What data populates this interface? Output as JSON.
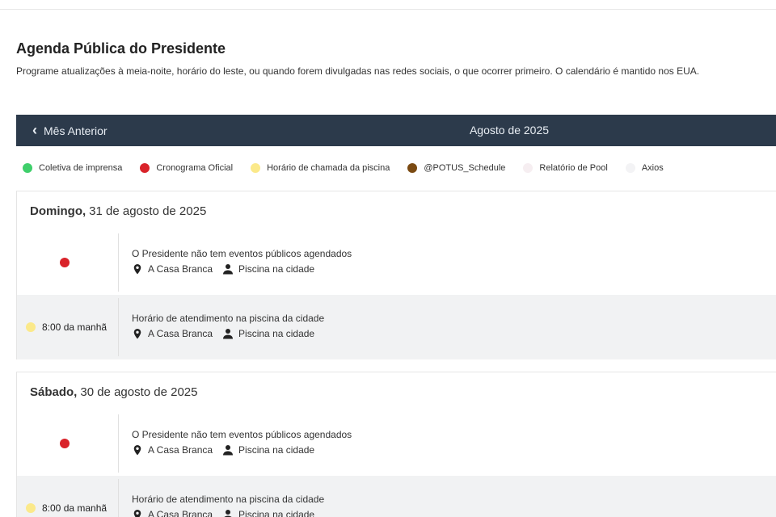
{
  "page": {
    "title": "Agenda Pública do Presidente",
    "description": "Programe atualizações à meia-noite, horário do leste, ou quando forem divulgadas nas redes sociais, o que ocorrer primeiro. O calendário é mantido nos EUA."
  },
  "nav": {
    "prev_label": "Mês Anterior",
    "month_label": "Agosto de 2025"
  },
  "legend": [
    {
      "label": "Coletiva de imprensa",
      "color": "#3fcf6b"
    },
    {
      "label": "Cronograma Oficial",
      "color": "#d9232a"
    },
    {
      "label": "Horário de chamada da piscina",
      "color": "#fbe98a"
    },
    {
      "label": "@POTUS_Schedule",
      "color": "#7b4a12"
    },
    {
      "label": "Relatório de Pool",
      "color": "#f6eef1"
    },
    {
      "label": "Axios",
      "color": "#f3f3f5"
    }
  ],
  "days": [
    {
      "weekday": "Domingo,",
      "date": "31 de agosto de 2025",
      "events": [
        {
          "time": "",
          "color": "#d9232a",
          "title": "O Presidente não tem eventos públicos agendados",
          "location": "A Casa Branca",
          "coverage": "Piscina na cidade"
        },
        {
          "time": "8:00 da manhã",
          "color": "#fbe98a",
          "title": "Horário de atendimento na piscina da cidade",
          "location": "A Casa Branca",
          "coverage": "Piscina na cidade"
        }
      ]
    },
    {
      "weekday": "Sábado,",
      "date": "30 de agosto de 2025",
      "events": [
        {
          "time": "",
          "color": "#d9232a",
          "title": "O Presidente não tem eventos públicos agendados",
          "location": "A Casa Branca",
          "coverage": "Piscina na cidade"
        },
        {
          "time": "8:00 da manhã",
          "color": "#fbe98a",
          "title": "Horário de atendimento na piscina da cidade",
          "location": "A Casa Branca",
          "coverage": "Piscina na cidade"
        }
      ]
    }
  ]
}
